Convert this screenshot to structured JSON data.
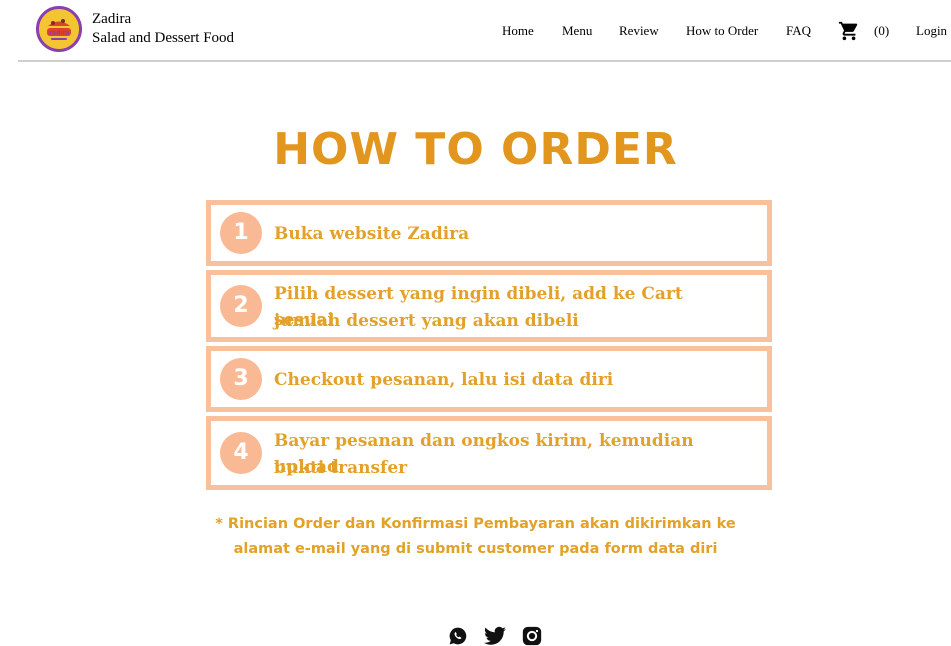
{
  "header": {
    "brand_name": "Zadira",
    "brand_tagline": "Salad and Dessert Food",
    "logo_text": "zadira",
    "nav": {
      "home": "Home",
      "menu": "Menu",
      "review": "Review",
      "how_to_order": "How to Order",
      "faq": "FAQ",
      "cart_count": "(0)",
      "login": "Login"
    }
  },
  "main": {
    "title": "HOW TO ORDER",
    "steps": [
      {
        "number": "1",
        "line1": "Buka website Zadira",
        "line2": ""
      },
      {
        "number": "2",
        "line1": "Pilih dessert yang ingin dibeli, add ke Cart sesuai",
        "line2": "jumlah dessert yang akan dibeli"
      },
      {
        "number": "3",
        "line1": "Checkout pesanan, lalu isi data diri",
        "line2": ""
      },
      {
        "number": "4",
        "line1": "Bayar pesanan dan ongkos kirim, kemudian upload",
        "line2": "bukti transfer"
      }
    ],
    "note_line1": "* Rincian Order dan Konfirmasi Pembayaran akan dikirimkan ke",
    "note_line2": "alamat e-mail yang di submit customer pada form data diri"
  },
  "footer": {
    "icons": [
      "whatsapp-icon",
      "twitter-icon",
      "instagram-icon"
    ]
  },
  "colors": {
    "title": "#e2961e",
    "step_border": "#f9c09c",
    "step_circle": "#f9b994",
    "step_text": "#e3a12a",
    "note": "#e2a128"
  }
}
